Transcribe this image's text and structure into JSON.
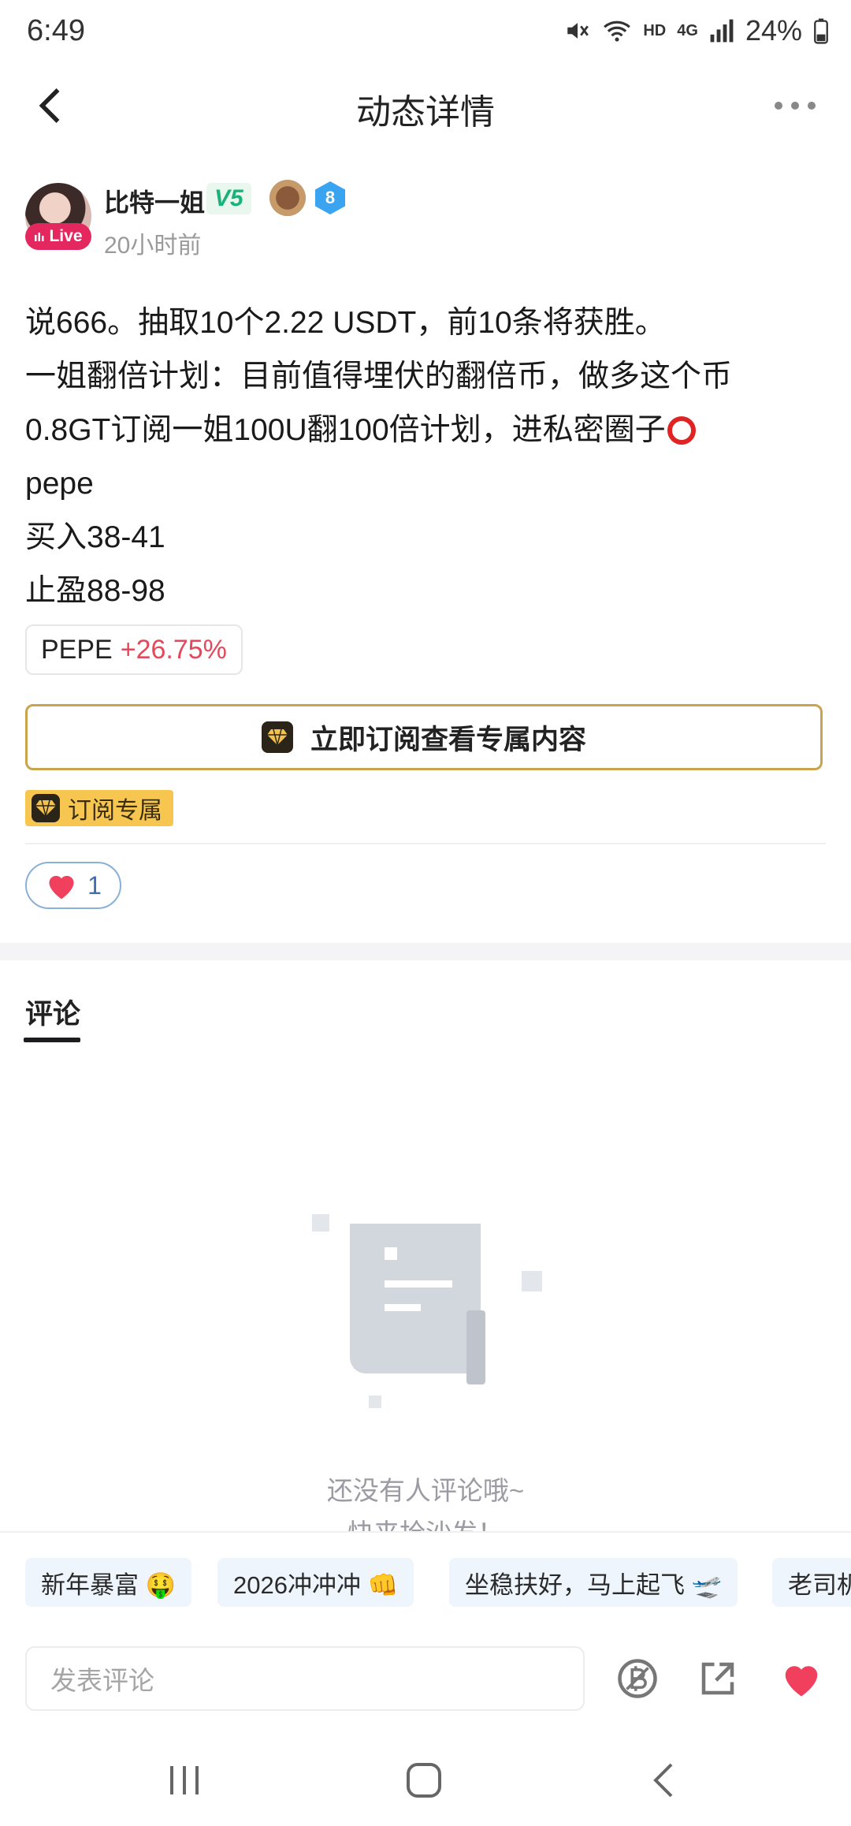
{
  "status_bar": {
    "time": "6:49",
    "network": "HD",
    "network_type": "4G",
    "battery": "24%"
  },
  "header": {
    "title": "动态详情"
  },
  "author": {
    "name": "比特一姐",
    "vip_level": "V5",
    "rank": "8",
    "live_label": "Live",
    "time_ago": "20小时前"
  },
  "post": {
    "lines": [
      "说666。抽取10个2.22 USDT，前10条将获胜。",
      "一姐翻倍计划：目前值得埋伏的翻倍币，做多这个币",
      "0.8GT订阅一姐100U翻100倍计划，进私密圈子",
      "pepe",
      "买入38-41",
      "止盈88-98"
    ],
    "coin": {
      "symbol": "PEPE",
      "change": "+26.75%"
    },
    "subscribe_button": "立即订阅查看专属内容",
    "subscribe_tag": "订阅专属",
    "likes": "1"
  },
  "comments": {
    "tab_label": "评论",
    "empty_text": "还没有人评论哦~",
    "empty_text2": "快来抢沙发！",
    "quick_chips": [
      "新年暴富 🤑",
      "2026冲冲冲 👊",
      "坐稳扶好，马上起飞 🛫",
      "老司机"
    ],
    "input_placeholder": "发表评论"
  },
  "colors": {
    "accent_red": "#e24a5b",
    "gold": "#c9a44c",
    "live_pink": "#e4285f",
    "like_blue": "#3d6fb1"
  }
}
